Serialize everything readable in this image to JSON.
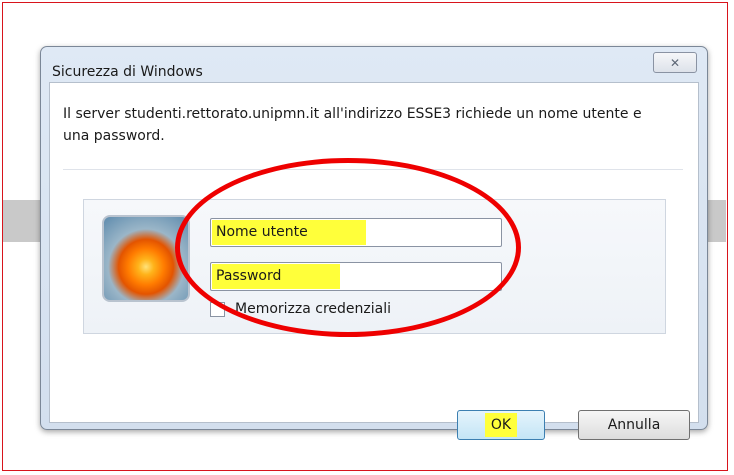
{
  "dialog": {
    "title": "Sicurezza di Windows",
    "close_glyph": "✕",
    "message": "Il server studenti.rettorato.unipmn.it all'indirizzo ESSE3 richiede un nome utente e una password."
  },
  "form": {
    "username_label": "Nome utente",
    "password_label": "Password",
    "remember_label": "Memorizza credenziali",
    "remember_checked": false
  },
  "buttons": {
    "ok": "OK",
    "cancel": "Annulla"
  },
  "annotations": {
    "highlight_color": "#ffff3a",
    "circle_color": "#ee0000",
    "frame_color": "#d8141c"
  }
}
